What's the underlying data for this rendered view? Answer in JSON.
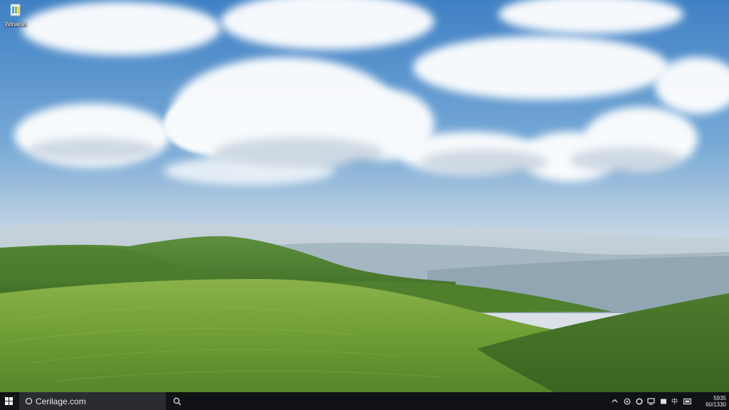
{
  "desktop": {
    "icons": [
      {
        "label": "Winaras",
        "icon": "recycle-bin-icon"
      }
    ]
  },
  "taskbar": {
    "start_icon": "windows-logo-icon",
    "search": {
      "text": "Cerilage.com",
      "icon": "search-icon"
    },
    "search_button_icon": "search-icon",
    "tray_icons": [
      "chevron-up-icon",
      "network-icon",
      "settings-icon",
      "display-icon",
      "tablet-icon",
      "input-icon",
      "keyboard-icon"
    ],
    "clock": {
      "time": "5935",
      "date": "60/1330"
    }
  },
  "colors": {
    "taskbar": "#101216",
    "search_box": "#2a2c31",
    "accent": "#3a8ee6"
  }
}
